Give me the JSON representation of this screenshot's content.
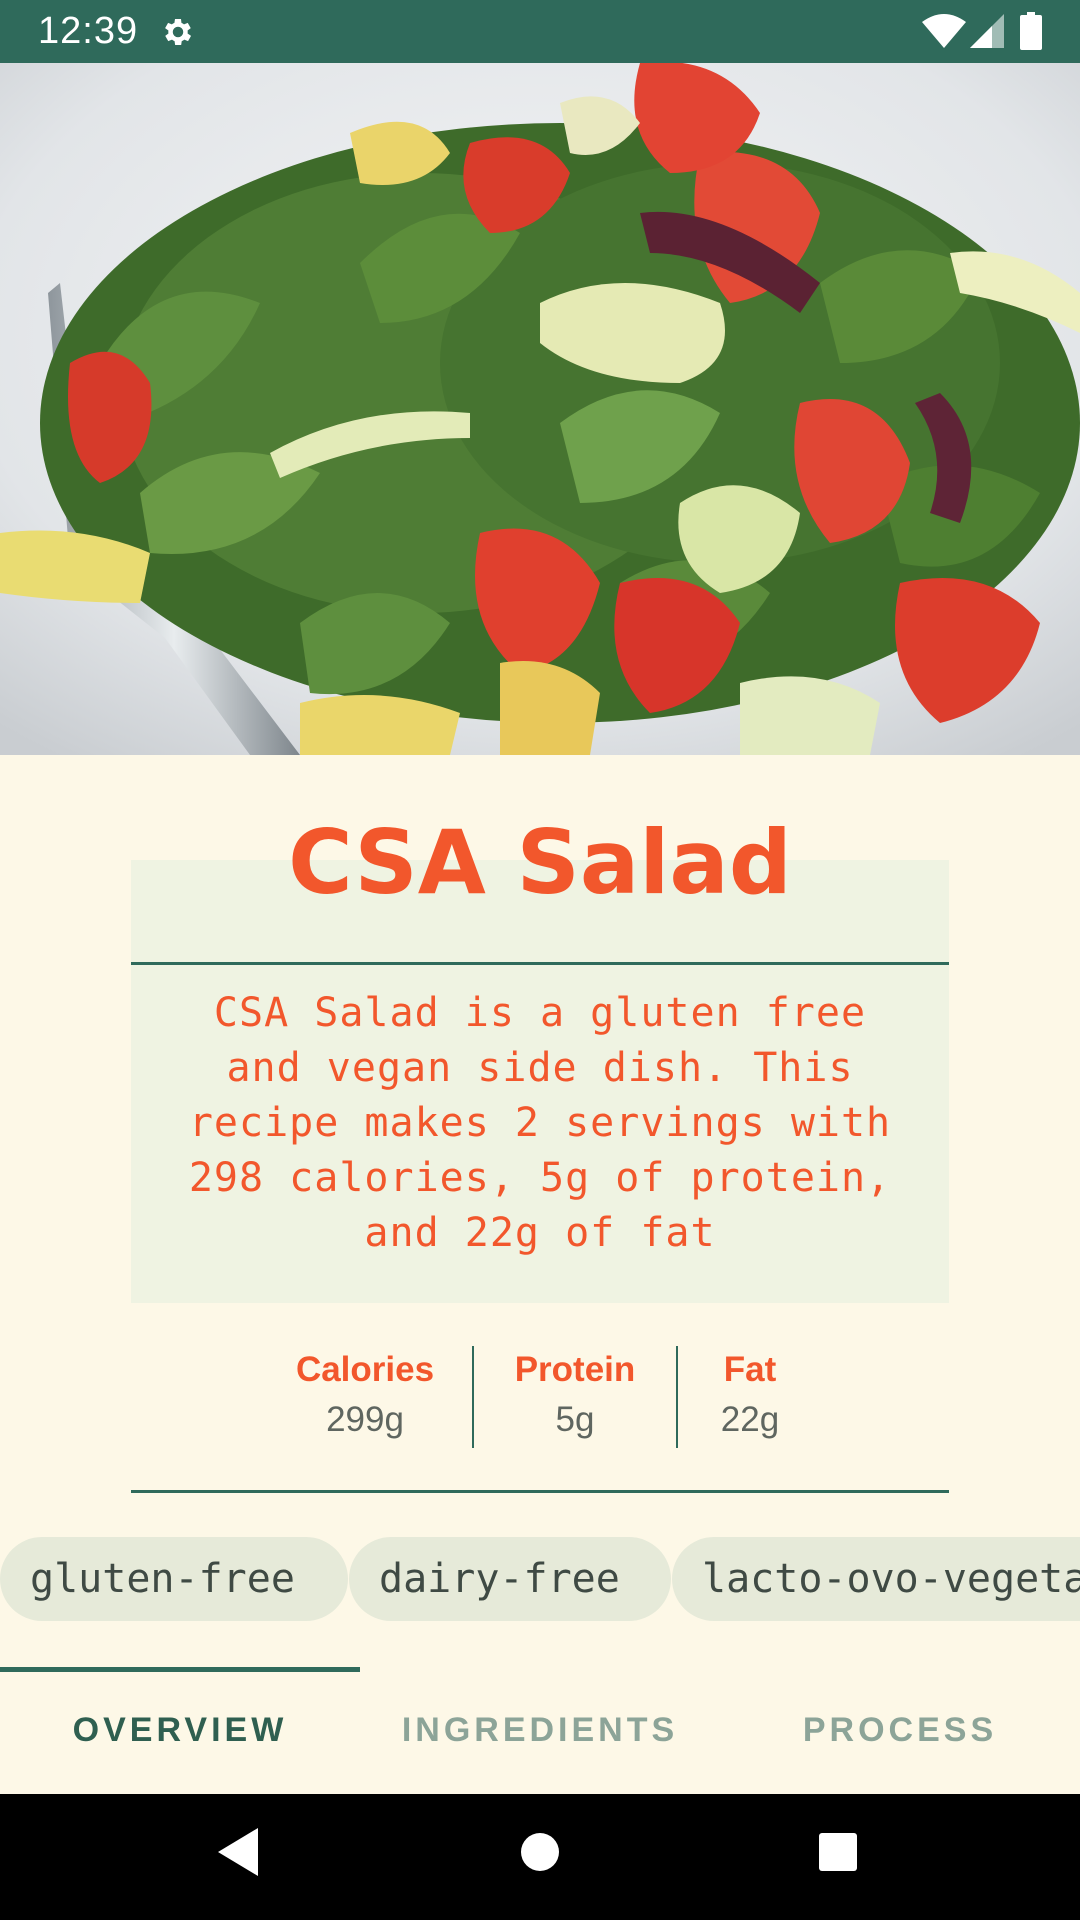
{
  "status_bar": {
    "time": "12:39",
    "icons": [
      "gear-icon",
      "wifi-icon",
      "signal-icon",
      "battery-icon"
    ]
  },
  "hero": {
    "image": "salad-photo"
  },
  "recipe": {
    "title": "CSA Salad",
    "description": "CSA Salad is a gluten free and vegan side dish. This recipe makes 2 servings with 298 calories, 5g of protein, and 22g of fat"
  },
  "nutrition": [
    {
      "label": "Calories",
      "value": "299g"
    },
    {
      "label": "Protein",
      "value": "5g"
    },
    {
      "label": "Fat",
      "value": "22g"
    }
  ],
  "tags": [
    "gluten-free",
    "dairy-free",
    "lacto-ovo-vegetarian"
  ],
  "tabs": [
    {
      "label": "OVERVIEW",
      "active": true
    },
    {
      "label": "INGREDIENTS",
      "active": false
    },
    {
      "label": "PROCESS",
      "active": false
    }
  ],
  "nav_bar": {
    "icons": [
      "back-icon",
      "home-icon",
      "recents-icon"
    ]
  },
  "colors": {
    "primary": "#2F6A5B",
    "accent": "#F2572C",
    "background": "#FDF8E7",
    "panel": "#EFF3E2"
  }
}
